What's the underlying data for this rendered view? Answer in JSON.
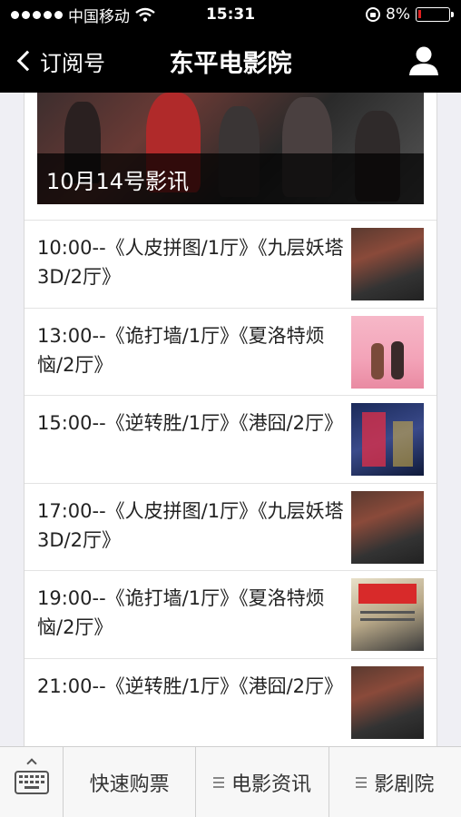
{
  "status_bar": {
    "carrier": "中国移动",
    "time": "15:31",
    "battery": "8%",
    "battery_level": 0.08,
    "icons": [
      "signal-dots",
      "wifi-icon",
      "rotation-lock-icon",
      "battery-icon"
    ]
  },
  "nav": {
    "back_label": "订阅号",
    "title": "东平电影院",
    "icons": [
      "chevron-left-icon",
      "user-icon"
    ]
  },
  "banner": {
    "caption": "10月14号影讯"
  },
  "schedule": [
    {
      "text": "10:00--《人皮拼图/1厅》《九层妖塔3D/2厅》",
      "thumb": "dark"
    },
    {
      "text": "13:00--《诡打墙/1厅》《夏洛特烦恼/2厅》",
      "thumb": "pink"
    },
    {
      "text": "15:00--《逆转胜/1厅》《港囧/2厅》",
      "thumb": "blue"
    },
    {
      "text": "17:00--《人皮拼图/1厅》《九层妖塔3D/2厅》",
      "thumb": "dark"
    },
    {
      "text": "19:00--《诡打墙/1厅》《夏洛特烦恼/2厅》",
      "thumb": "news"
    },
    {
      "text": "21:00--《逆转胜/1厅》《港囧/2厅》",
      "thumb": "dark"
    }
  ],
  "bottom_menu": {
    "keyboard_icon": "keyboard-icon",
    "items": [
      {
        "label": "快速购票",
        "has_menu_icon": false
      },
      {
        "label": "电影资讯",
        "has_menu_icon": true
      },
      {
        "label": "影剧院",
        "has_menu_icon": true
      }
    ]
  }
}
